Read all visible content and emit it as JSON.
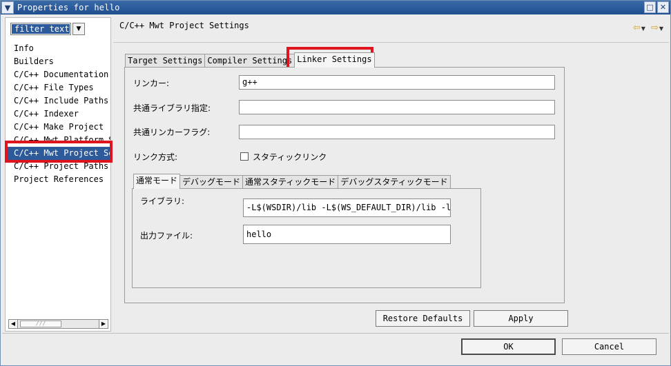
{
  "window": {
    "title": "Properties for hello",
    "menu_icon": "chevron-down-icon",
    "maximize_icon": "maximize-icon",
    "close_icon": "close-icon"
  },
  "sidebar": {
    "filter_text": "filter text",
    "items": [
      {
        "label": "Info"
      },
      {
        "label": "Builders"
      },
      {
        "label": "C/C++ Documentation"
      },
      {
        "label": "C/C++ File Types"
      },
      {
        "label": "C/C++ Include Paths"
      },
      {
        "label": "C/C++ Indexer"
      },
      {
        "label": "C/C++ Make Project"
      },
      {
        "label": "C/C++ Mwt Platform S"
      },
      {
        "label": "C/C++ Mwt Project Se"
      },
      {
        "label": "C/C++ Project Paths"
      },
      {
        "label": "Project References"
      }
    ],
    "selected_index": 8,
    "scroll_thumb_glyph": "///"
  },
  "header": {
    "title": "C/C++ Mwt Project Settings",
    "back_icon": "back-arrow-icon",
    "forward_icon": "forward-arrow-icon"
  },
  "outer_tabs": [
    {
      "label": "Target Settings"
    },
    {
      "label": "Compiler Settings"
    },
    {
      "label": "Linker Settings"
    }
  ],
  "linker": {
    "linker_label": "リンカー:",
    "linker_value": "g++",
    "common_lib_label": "共通ライブラリ指定:",
    "common_lib_value": "",
    "common_flag_label": "共通リンカーフラグ:",
    "common_flag_value": "",
    "link_mode_label": "リンク方式:",
    "static_link_label": "スタティックリンク",
    "static_link_checked": false
  },
  "inner_tabs": [
    {
      "label": "通常モード"
    },
    {
      "label": "デバッグモード"
    },
    {
      "label": "通常スタティックモード"
    },
    {
      "label": "デバッグスタティックモード"
    }
  ],
  "inner": {
    "library_label": "ライブラリ:",
    "library_value": "-L$(WSDIR)/lib -L$(WS_DEFAULT_DIR)/lib -lw",
    "output_label": "出力ファイル:",
    "output_value": "hello"
  },
  "buttons": {
    "restore_defaults": "Restore Defaults",
    "apply": "Apply",
    "ok": "OK",
    "cancel": "Cancel"
  },
  "colors": {
    "highlight": "#e0141e",
    "selection": "#2d5a9a",
    "titlebar": "#2d5a9a"
  }
}
